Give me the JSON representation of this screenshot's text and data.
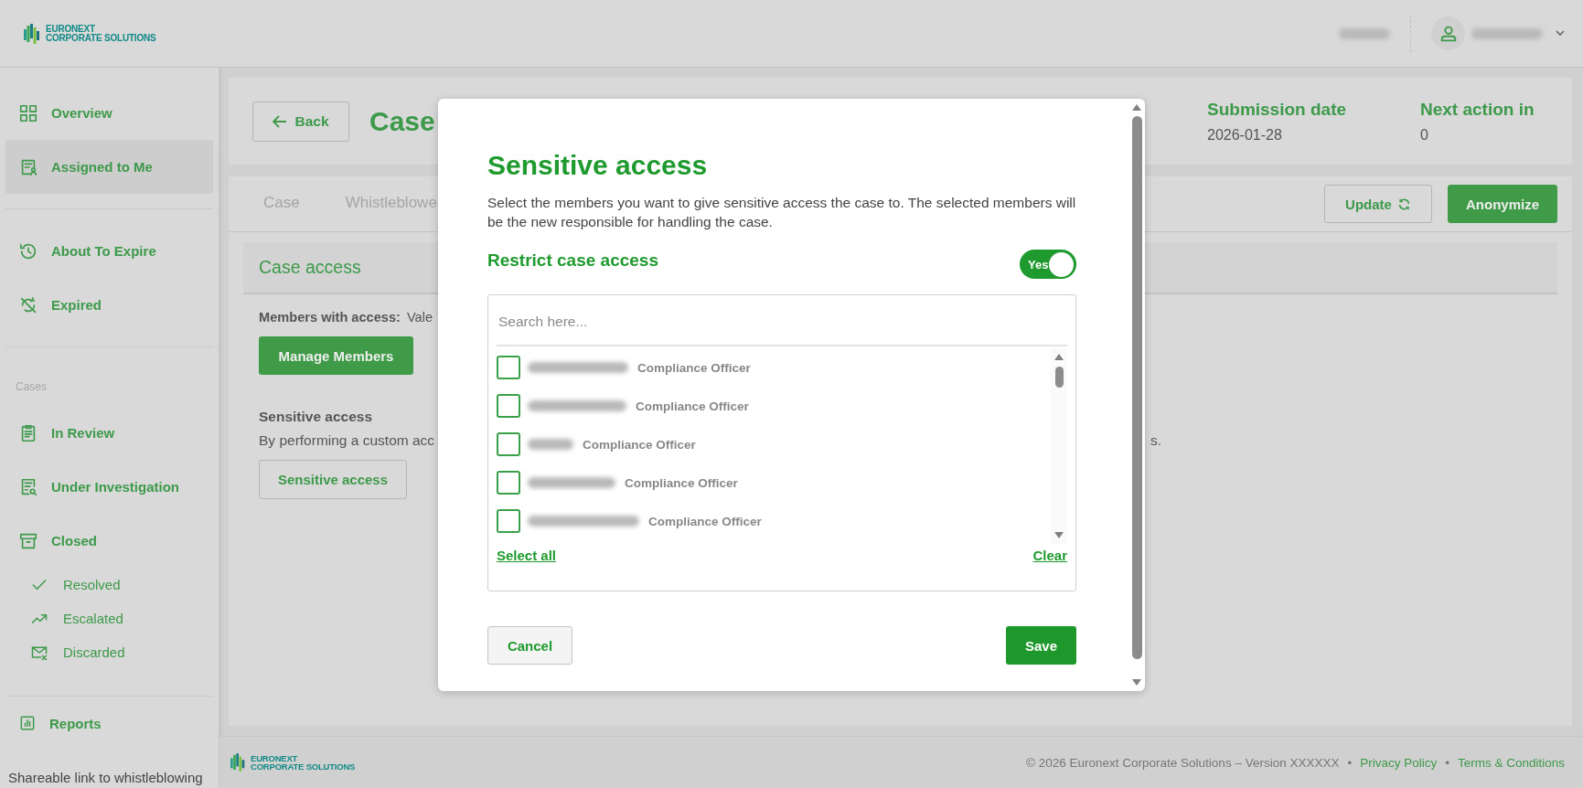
{
  "header": {
    "logo": {
      "line1": "EURONEXT",
      "line2": "CORPORATE SOLUTIONS"
    }
  },
  "sidebar": {
    "groups": [
      {
        "items": [
          {
            "label": "Overview",
            "selected": false
          },
          {
            "label": "Assigned to Me",
            "selected": true
          }
        ]
      },
      {
        "items": [
          {
            "label": "About To Expire",
            "selected": false
          },
          {
            "label": "Expired",
            "selected": false
          }
        ]
      },
      {
        "heading": "Cases",
        "items": [
          {
            "label": "In Review",
            "selected": false
          },
          {
            "label": "Under Investigation",
            "selected": false
          },
          {
            "label": "Closed",
            "selected": false,
            "children": [
              {
                "label": "Resolved",
                "selected": false
              },
              {
                "label": "Escalated",
                "selected": false
              },
              {
                "label": "Discarded",
                "selected": false
              }
            ]
          }
        ]
      },
      {
        "items": [
          {
            "label": "Reports",
            "selected": false
          }
        ]
      }
    ],
    "share_link": "Shareable link to whistleblowing"
  },
  "case_header": {
    "back": "Back",
    "title": "Case",
    "fields": [
      {
        "label": "Submission date",
        "value": "2026-01-28"
      },
      {
        "label": "Next action in",
        "value": "0"
      }
    ]
  },
  "tabs": [
    {
      "label": "Case",
      "selected": false
    },
    {
      "label": "Whistleblowe",
      "selected": false
    }
  ],
  "actions": [
    {
      "kind": "secondary",
      "label": "Update"
    },
    {
      "kind": "primary",
      "label": "Anonymize"
    }
  ],
  "case_access": {
    "title": "Case access",
    "members_label": "Members with access:",
    "members_value": "Vale",
    "manage_button": "Manage Members",
    "sensitive_title": "Sensitive access",
    "sensitive_text": "By performing a custom acc",
    "sensitive_text_end": "s.",
    "sensitive_button": "Sensitive access"
  },
  "modal": {
    "title": "Sensitive access",
    "description": "Select the members you want to give sensitive access the case to. The selected members will be the new responsible for handling the case.",
    "restrict_label": "Restrict case access",
    "restrict_toggle": {
      "on": true,
      "label": "Yes"
    },
    "search": {
      "placeholder": "Search here..."
    },
    "members": [
      {
        "role": "Compliance Officer",
        "checked": false
      },
      {
        "role": "Compliance Officer",
        "checked": false
      },
      {
        "role": "Compliance Officer",
        "checked": false
      },
      {
        "role": "Compliance Officer",
        "checked": false
      },
      {
        "role": "Compliance Officer",
        "checked": false
      }
    ],
    "select_all": "Select all",
    "clear": "Clear",
    "cancel": "Cancel",
    "save": "Save"
  },
  "footer": {
    "logo": {
      "line1": "EURONEXT",
      "line2": "CORPORATE SOLUTIONS"
    },
    "items": [
      {
        "kind": "text",
        "text": "© 2026 Euronext Corporate Solutions – Version XXXXXX"
      },
      {
        "kind": "bullet",
        "text": "•"
      },
      {
        "kind": "link",
        "text": "Privacy Policy"
      },
      {
        "kind": "bullet",
        "text": "•"
      },
      {
        "kind": "link",
        "text": "Terms & Conditions"
      }
    ]
  }
}
